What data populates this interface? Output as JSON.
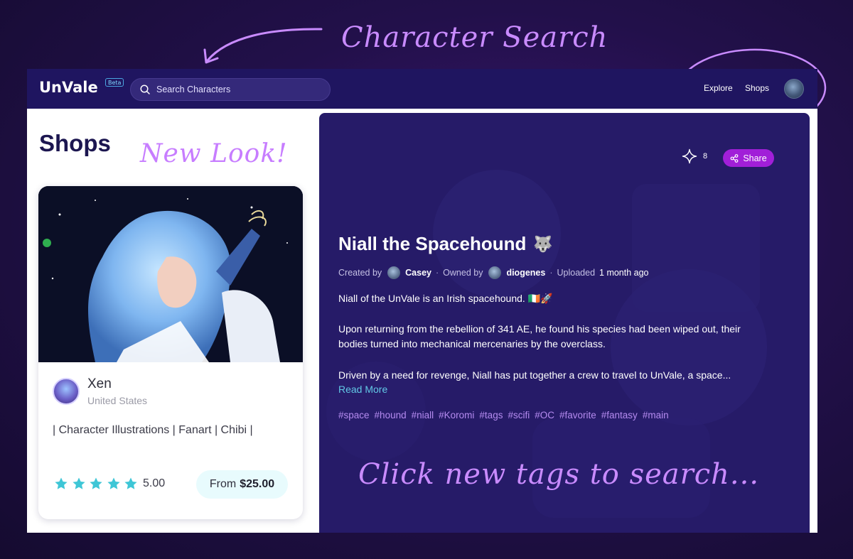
{
  "annotations": {
    "search": "Character Search",
    "look": "New Look!",
    "tags": "Click new tags to search..."
  },
  "header": {
    "logo": "UnVale",
    "beta": "Beta",
    "search_placeholder": "Search Characters",
    "nav": [
      "Explore",
      "Shops"
    ]
  },
  "left": {
    "title": "Shops",
    "shop": {
      "name": "Xen",
      "location": "United States",
      "description": "| Character Illustrations | Fanart | Chibi |",
      "rating": "5.00",
      "stars": 5,
      "price_prefix": "From",
      "price": "$25.00"
    }
  },
  "character": {
    "favorites": "8",
    "share_label": "Share",
    "name": "Niall the Spacehound",
    "name_emoji": "🐺",
    "created_by_label": "Created by",
    "creator": "Casey",
    "owned_by_label": "Owned by",
    "owner": "diogenes",
    "uploaded_label": "Uploaded",
    "uploaded": "1 month ago",
    "para1": "Niall of the UnVale is an Irish spacehound. 🇮🇪🚀",
    "para2": "Upon returning from the rebellion of 341 AE, he found his species had been wiped out, their bodies turned into mechanical mercenaries by the overclass.",
    "para3": "Driven by a need for revenge, Niall has put together a crew to travel to UnVale, a space...",
    "read_more": "Read More",
    "tags": [
      "#space",
      "#hound",
      "#niall",
      "#Koromi",
      "#tags",
      "#scifi",
      "#OC",
      "#favorite",
      "#fantasy",
      "#main"
    ]
  },
  "colors": {
    "header_bg": "#1f1560",
    "panel_bg": "#261b68",
    "share": "#a11fd8",
    "accent_teal": "#3ec6d6",
    "tag": "#b58bf0",
    "annotation": "#c98bff"
  }
}
